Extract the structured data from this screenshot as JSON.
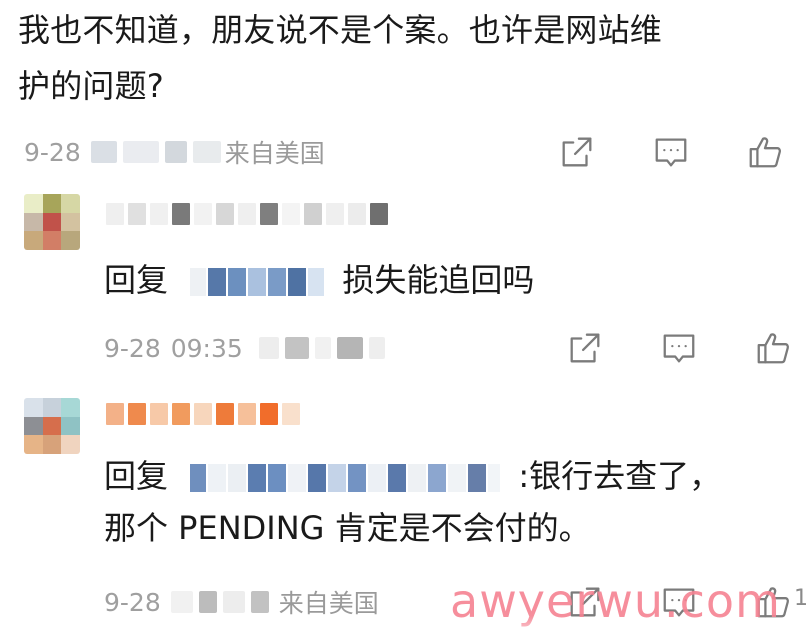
{
  "top_comment": {
    "text_line1": "我也不知道，朋友说不是个案。也许是网站维",
    "text_line2": "护的问题?",
    "date": "9-28",
    "origin": "来自美国"
  },
  "reply1": {
    "prefix": "回复",
    "suffix": "损失能追回吗",
    "date": "9-28",
    "time": "09:35"
  },
  "reply2": {
    "prefix": "回复",
    "suffix": ":银行去查了，",
    "line2": "那个 PENDING 肯定是不会付的。",
    "date": "9-28",
    "origin": "来自美国"
  },
  "actions": {
    "share_icon": "share-icon",
    "comment_icon": "comment-icon",
    "like_icon": "like-icon",
    "like_count": "1"
  },
  "watermark": "awyerwu.com",
  "colors": {
    "text_primary": "#1a1a1a",
    "text_meta": "#9a9a9a",
    "icon_stroke": "#7b7b7b",
    "watermark": "#f58291"
  }
}
